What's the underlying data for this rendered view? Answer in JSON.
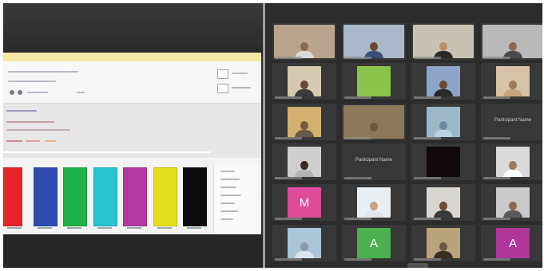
{
  "shared_screen": {
    "swatches": [
      {
        "name": "red",
        "color": "#e8222a"
      },
      {
        "name": "blue",
        "color": "#2f4cb0"
      },
      {
        "name": "green",
        "color": "#1fb14a"
      },
      {
        "name": "cyan",
        "color": "#28c2d0"
      },
      {
        "name": "magenta",
        "color": "#b3399f"
      },
      {
        "name": "yellow",
        "color": "#e4df1d"
      },
      {
        "name": "black",
        "color": "#0c0c0c"
      }
    ]
  },
  "gallery": {
    "tiles": [
      {
        "kind": "video",
        "bg": "#b9a58c",
        "skin": "#8a6b52",
        "shirt": "#d8d8d8"
      },
      {
        "kind": "video",
        "bg": "#a9b9c9",
        "skin": "#6a4a35",
        "shirt": "#3b4e79"
      },
      {
        "kind": "video",
        "bg": "#c9c2b2",
        "skin": "#b98e6a",
        "shirt": "#2a2a2a"
      },
      {
        "kind": "video",
        "bg": "#b9b9b9",
        "skin": "#8a6a55",
        "shirt": "#4a4a4a"
      },
      {
        "kind": "video",
        "bg": "#d5cab0",
        "skin": "#6a4a38",
        "shirt": "#3a3a3a"
      },
      {
        "kind": "avatar",
        "bg": "#8bc44a",
        "letter": ""
      },
      {
        "kind": "video",
        "bg": "#8fa4c9",
        "skin": "#6a4a35",
        "shirt": "#2a2a2a"
      },
      {
        "kind": "video",
        "bg": "#d7c3a5",
        "skin": "#a07a5a",
        "shirt": "#c9a37a"
      },
      {
        "kind": "video",
        "bg": "#d3b070",
        "skin": "#7a5a40",
        "shirt": "#6a5a45"
      },
      {
        "kind": "video",
        "bg": "#8a7a5a",
        "skin": "#6a5a40",
        "shirt": "#8a7a5a"
      },
      {
        "kind": "video",
        "bg": "#9cb8c7",
        "skin": "#6a8aa0",
        "shirt": "#b7d3de"
      },
      {
        "kind": "name",
        "text": "Participant Name"
      },
      {
        "kind": "video",
        "bg": "#cfcfcf",
        "skin": "#3a2a25",
        "shirt": "#b3b3b3"
      },
      {
        "kind": "name",
        "text": "Participant Name"
      },
      {
        "kind": "avatar",
        "bg": "#120a0a",
        "letter": ""
      },
      {
        "kind": "video",
        "bg": "#d9d9d9",
        "skin": "#9a7a60",
        "shirt": "#ffffff"
      },
      {
        "kind": "avatar",
        "bg": "#e04a9a",
        "letter": "M"
      },
      {
        "kind": "video",
        "bg": "#e9eef2",
        "skin": "#c9a383",
        "shirt": "#dfe6ec"
      },
      {
        "kind": "video",
        "bg": "#d9d5d0",
        "skin": "#6a4a38",
        "shirt": "#3a3a3a"
      },
      {
        "kind": "video",
        "bg": "#c9c9c9",
        "skin": "#8a6a55",
        "shirt": "#5a5a5a"
      },
      {
        "kind": "video",
        "bg": "#a9c6d9",
        "skin": "#8a9aa9",
        "shirt": "#d9e6ef"
      },
      {
        "kind": "avatar",
        "bg": "#4bb04f",
        "letter": "A"
      },
      {
        "kind": "video",
        "bg": "#b9a37a",
        "skin": "#6a5a40",
        "shirt": "#3a3020"
      },
      {
        "kind": "avatar",
        "bg": "#b0369a",
        "letter": "A"
      }
    ]
  }
}
